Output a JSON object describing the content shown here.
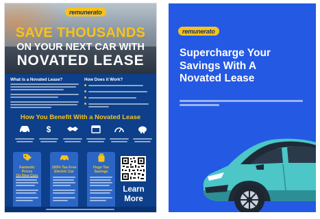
{
  "brand": {
    "logo_text": "remunerato",
    "logo_color": "#f7c31b",
    "navy": "#0d3f8a",
    "blue": "#2459e3"
  },
  "left_flyer": {
    "headline_line1": "SAVE THOUSANDS",
    "headline_line2": "ON YOUR NEXT CAR WITH",
    "headline_line3": "NOVATED LEASE",
    "col1_title": "What is a Novated Lease?",
    "col2_title": "How Does it Work?",
    "benefits_heading": "How You Benefit With a Novated Lease",
    "benefit_icons": [
      "car-icon",
      "dollar-icon",
      "handshake-icon",
      "calendar-icon",
      "speedometer-icon",
      "piggy-bank-icon"
    ],
    "cards": [
      {
        "icon": "tag-icon",
        "title_line1": "Fantastic Prices",
        "title_line2": "On New Cars"
      },
      {
        "icon": "car-icon",
        "title_line1": "100% Tax-Free",
        "title_line2": "Electric Car"
      },
      {
        "icon": "jar-icon",
        "title_line1": "Huge Tax",
        "title_line2": "Savings"
      }
    ],
    "cta_line1": "Learn",
    "cta_line2": "More"
  },
  "right_page": {
    "headline_line1": "Supercharge Your",
    "headline_line2": "Savings With A",
    "headline_line3": "Novated Lease"
  }
}
